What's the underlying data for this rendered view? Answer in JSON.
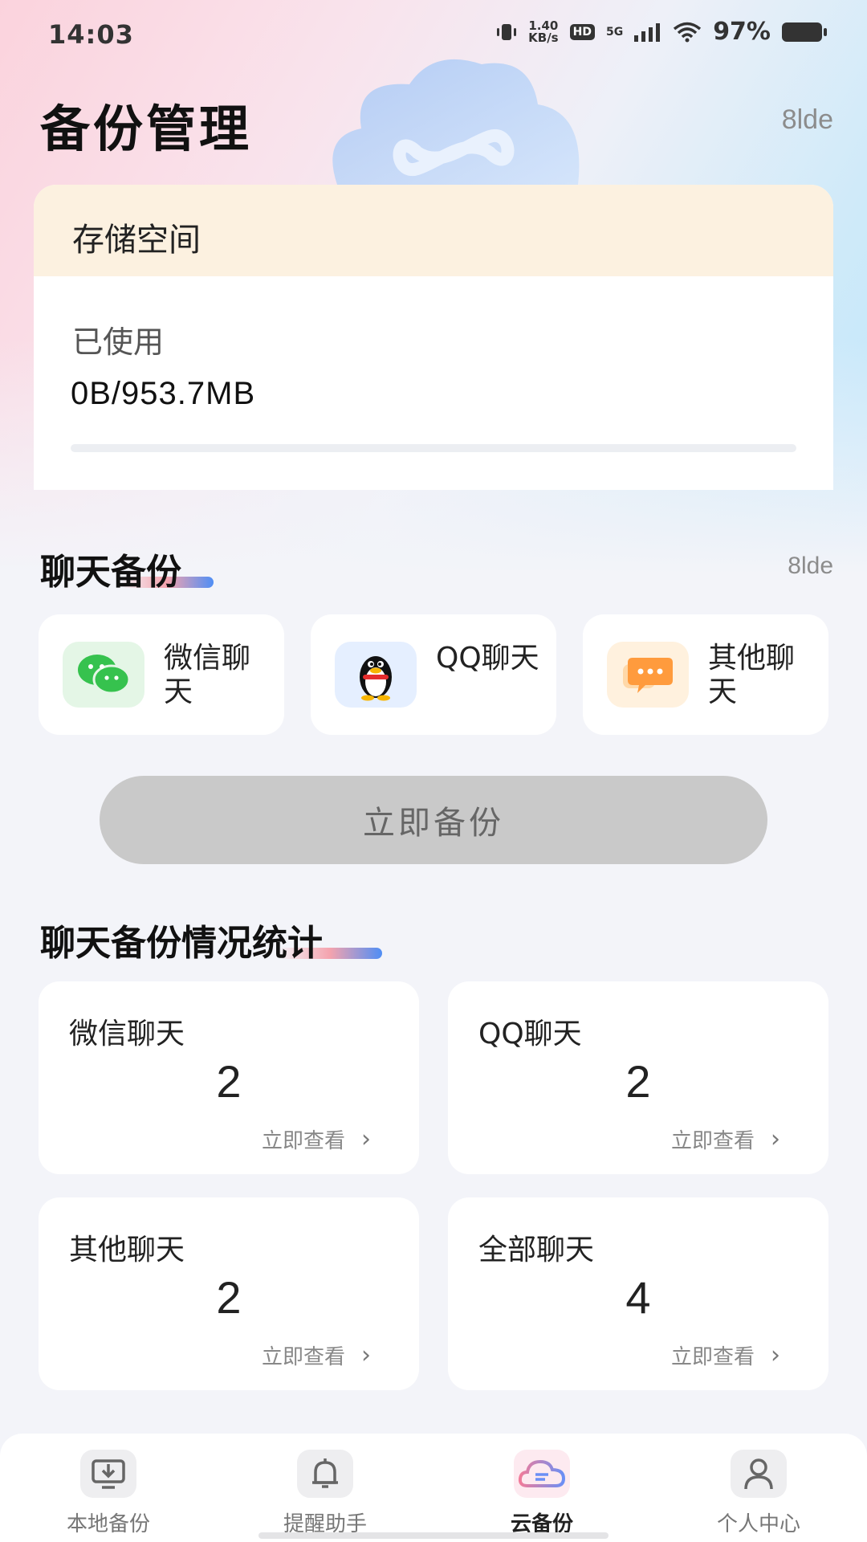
{
  "status_bar": {
    "time": "14:03",
    "net_speed_value": "1.40",
    "net_speed_unit": "KB/s",
    "hd_badge": "HD",
    "network": "5G",
    "battery": "97%"
  },
  "header": {
    "title": "备份管理",
    "corner_label": "8lde"
  },
  "storage": {
    "title": "存储空间",
    "used_label": "已使用",
    "used_value": "0B/953.7MB",
    "used_fraction": 0
  },
  "chat_backup": {
    "title": "聊天备份",
    "corner_label": "8lde",
    "items": [
      {
        "label": "微信聊天",
        "icon": "wechat-icon",
        "color": "#36c24e"
      },
      {
        "label": "QQ聊天",
        "icon": "qq-penguin-icon",
        "color": "#1e88ff"
      },
      {
        "label": "其他聊天",
        "icon": "chat-bubble-icon",
        "color": "#ff9b3d"
      }
    ],
    "backup_button": "立即备份"
  },
  "stats": {
    "title": "聊天备份情况统计",
    "cards": [
      {
        "title": "微信聊天",
        "count": "2",
        "link": "立即查看"
      },
      {
        "title": "QQ聊天",
        "count": "2",
        "link": "立即查看"
      },
      {
        "title": "其他聊天",
        "count": "2",
        "link": "立即查看"
      },
      {
        "title": "全部聊天",
        "count": "4",
        "link": "立即查看"
      }
    ]
  },
  "bottom_nav": {
    "items": [
      {
        "label": "本地备份",
        "icon": "local-backup-icon"
      },
      {
        "label": "提醒助手",
        "icon": "bell-icon"
      },
      {
        "label": "云备份",
        "icon": "cloud-icon",
        "active": true
      },
      {
        "label": "个人中心",
        "icon": "person-icon"
      }
    ]
  },
  "colors": {
    "accent_blue": "#4f8ef5",
    "accent_pink": "#f4a3ae",
    "button_disabled": "#c9c9c9",
    "storage_header_bg": "#fcf1e0"
  }
}
